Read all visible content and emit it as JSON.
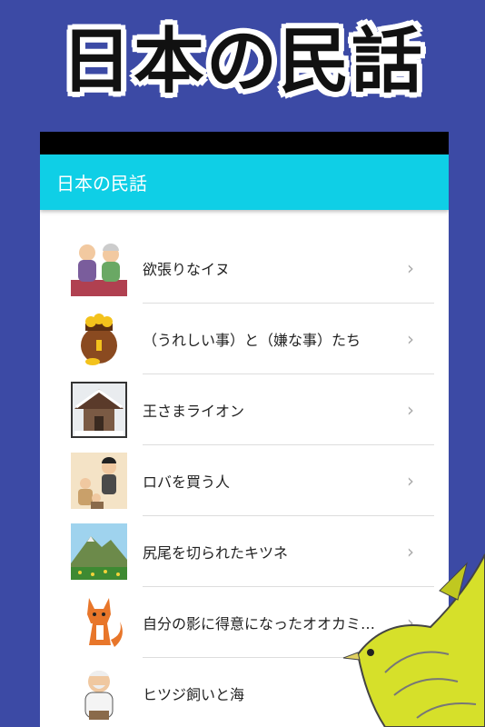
{
  "banner": {
    "title": "日本の民話"
  },
  "app_bar": {
    "title": "日本の民話"
  },
  "stories": [
    {
      "title": "欲張りなイヌ",
      "icon": "elderly-couple-thumbnail"
    },
    {
      "title": "（うれしい事）と（嫌な事）たち",
      "icon": "gold-jar-thumbnail"
    },
    {
      "title": "王さまライオン",
      "icon": "snowy-house-thumbnail"
    },
    {
      "title": "ロバを買う人",
      "icon": "market-people-thumbnail"
    },
    {
      "title": "尻尾を切られたキツネ",
      "icon": "mountain-thumbnail"
    },
    {
      "title": "自分の影に得意になったオオカミ…",
      "icon": "fox-thumbnail"
    },
    {
      "title": "ヒツジ飼いと海",
      "icon": "old-man-thumbnail"
    }
  ],
  "colors": {
    "background": "#3c4aa5",
    "app_bar": "#0fcfe6",
    "status_bar": "#000000"
  }
}
